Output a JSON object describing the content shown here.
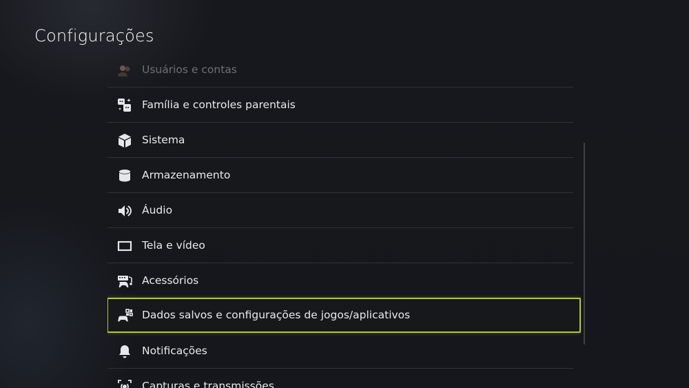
{
  "page": {
    "title": "Configurações"
  },
  "menu": {
    "items": [
      {
        "label": "Usuários e contas",
        "icon": "users-accounts-icon"
      },
      {
        "label": "Família e controles parentais",
        "icon": "family-parental-icon"
      },
      {
        "label": "Sistema",
        "icon": "system-cube-icon"
      },
      {
        "label": "Armazenamento",
        "icon": "storage-cylinder-icon"
      },
      {
        "label": "Áudio",
        "icon": "speaker-icon"
      },
      {
        "label": "Tela e vídeo",
        "icon": "screen-icon"
      },
      {
        "label": "Acessórios",
        "icon": "accessories-icon"
      },
      {
        "label": "Dados salvos e configurações de jogos/aplicativos",
        "icon": "saved-data-games-icon"
      },
      {
        "label": "Notificações",
        "icon": "bell-icon"
      },
      {
        "label": "Capturas e transmissões",
        "icon": "capture-broadcast-icon"
      }
    ],
    "selected_index": 7
  },
  "colors": {
    "background": "#15171c",
    "focus_border": "#b5c93a",
    "divider": "#2f3238",
    "text": "#e9eaec"
  }
}
